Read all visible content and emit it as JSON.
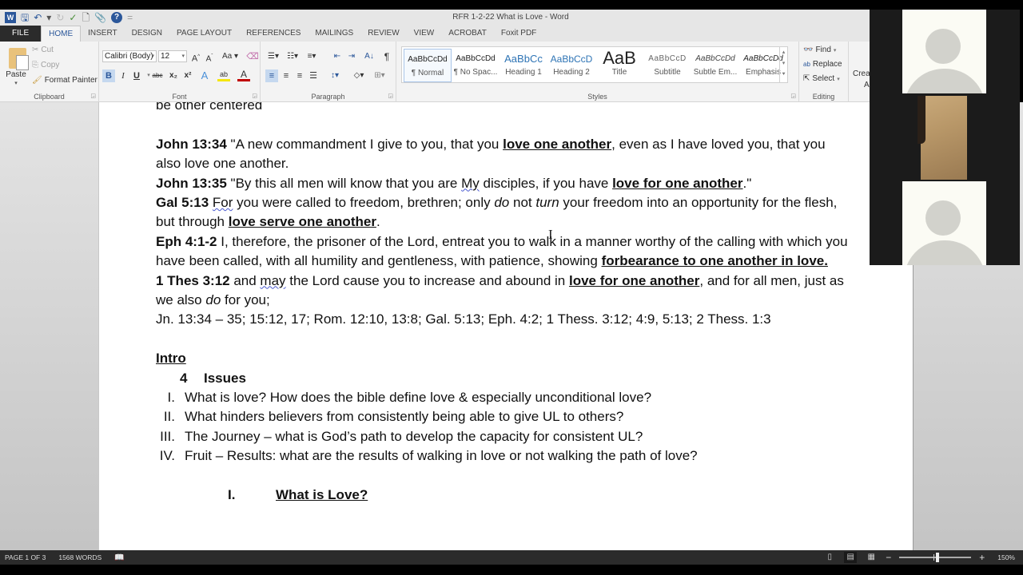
{
  "window": {
    "title": "RFR 1-2-22 What is Love - Word"
  },
  "quick_access": [
    {
      "icon": "word-logo-icon",
      "glyph": "W"
    },
    {
      "icon": "save-icon",
      "glyph": "🖫"
    },
    {
      "icon": "undo-icon",
      "glyph": "↶"
    },
    {
      "icon": "undo-dropdown-icon",
      "glyph": "▾"
    },
    {
      "icon": "redo-icon",
      "glyph": "↻"
    },
    {
      "icon": "spelling-grammar-icon",
      "glyph": "✓"
    },
    {
      "icon": "print-preview-icon",
      "glyph": "🗋"
    },
    {
      "icon": "attach-icon",
      "glyph": "📎"
    },
    {
      "icon": "help-icon",
      "glyph": "?"
    },
    {
      "icon": "customize-qat-icon",
      "glyph": "="
    }
  ],
  "tabs": [
    "FILE",
    "HOME",
    "INSERT",
    "DESIGN",
    "PAGE LAYOUT",
    "REFERENCES",
    "MAILINGS",
    "REVIEW",
    "VIEW",
    "ACROBAT",
    "Foxit PDF"
  ],
  "active_tab": "HOME",
  "ribbon": {
    "clipboard": {
      "label": "Clipboard",
      "paste": "Paste",
      "cut": "Cut",
      "copy": "Copy",
      "format_painter": "Format Painter"
    },
    "font": {
      "label": "Font",
      "font_name": "Calibri (Body)",
      "font_size": "12",
      "grow": "A",
      "shrink": "A",
      "change_case": "Aa",
      "bold": "B",
      "italic": "I",
      "underline": "U",
      "strike": "abc",
      "subscript": "x₂",
      "superscript": "x²",
      "text_effects": "A",
      "highlight": "ab",
      "font_color": "A",
      "highlight_color": "#f5e60a",
      "font_color_value": "#c00000"
    },
    "paragraph": {
      "label": "Paragraph"
    },
    "styles": {
      "label": "Styles",
      "items": [
        {
          "preview": "AaBbCcDd",
          "name": "¶ Normal"
        },
        {
          "preview": "AaBbCcDd",
          "name": "¶ No Spac..."
        },
        {
          "preview": "AaBbCc",
          "name": "Heading 1"
        },
        {
          "preview": "AaBbCcD",
          "name": "Heading 2"
        },
        {
          "preview": "AaB",
          "name": "Title"
        },
        {
          "preview": "AaBbCcD",
          "name": "Subtitle"
        },
        {
          "preview": "AaBbCcDd",
          "name": "Subtle Em..."
        },
        {
          "preview": "AaBbCcDd",
          "name": "Emphasis"
        }
      ],
      "active": "¶ Normal"
    },
    "editing": {
      "label": "Editing",
      "find": "Find",
      "replace": "Replace",
      "select": "Select"
    },
    "partial_group": {
      "line1": "Crea",
      "line2": "A"
    }
  },
  "document": {
    "line0": "be other centered",
    "john1334": {
      "ref": "John 13:34",
      "t1": " \"A new commandment I give to you, that you ",
      "b1": "love one another",
      "t2": ", even as I have loved you, that you also love one another."
    },
    "john1335": {
      "ref": "John 13:35",
      "t1": " \"By this all men will know that you are ",
      "sq": "My",
      "t2": " disciples, if you have ",
      "b1": "love for one another",
      "t3": ".\""
    },
    "gal513": {
      "ref": "Gal 5:13",
      "sp": " ",
      "sq": "For",
      "t1": " you were called to freedom, brethren; only ",
      "i1": "do",
      "t2": " not ",
      "i2": "turn",
      "t3": " your freedom into an opportunity for the flesh, but through ",
      "b1": "love serve one another",
      "t4": "."
    },
    "eph41": {
      "ref": "Eph 4:1-2",
      "t1": " I, therefore, the prisoner of the Lord, entreat you to walk in a manner worthy of the calling with which you have been called, with all humility and gentleness, with patience, showing ",
      "b1": "forbearance to one another in love."
    },
    "thes312": {
      "ref": "1 Thes 3:12",
      "t1": " and ",
      "sq": "may",
      "t2": " the Lord cause you to increase and abound in ",
      "b1": "love for one another",
      "t3": ", and for all men, just as we also ",
      "i1": "do",
      "t4": " for you;"
    },
    "refs": "Jn. 13:34 – 35; 15:12, 17; Rom. 12:10, 13:8; Gal. 5:13; Eph. 4:2; 1 Thess. 3:12; 4:9, 5:13; 2 Thess. 1:3",
    "intro": "Intro",
    "issues_num": "4",
    "issues_label": "Issues",
    "issues": [
      {
        "num": "I.",
        "text": "What is love? How does the bible define love & especially unconditional love?"
      },
      {
        "num": "II.",
        "text": "What hinders believers from consistently being able to give UL to others?"
      },
      {
        "num": "III.",
        "text": "The Journey – what is God’s path to develop the capacity for consistent UL?"
      },
      {
        "num": "IV.",
        "text": "Fruit – Results: what are the results of walking in love or not walking the path of love?"
      }
    ],
    "section_num": "I.",
    "section_title": "What is Love?"
  },
  "video_tiles": [
    {
      "type": "avatar"
    },
    {
      "type": "camera"
    },
    {
      "type": "avatar"
    }
  ],
  "status": {
    "page": "PAGE 1 OF 3",
    "words": "1568 WORDS",
    "zoom_level": "150%",
    "zoom_minus": "−",
    "zoom_plus": "+"
  }
}
